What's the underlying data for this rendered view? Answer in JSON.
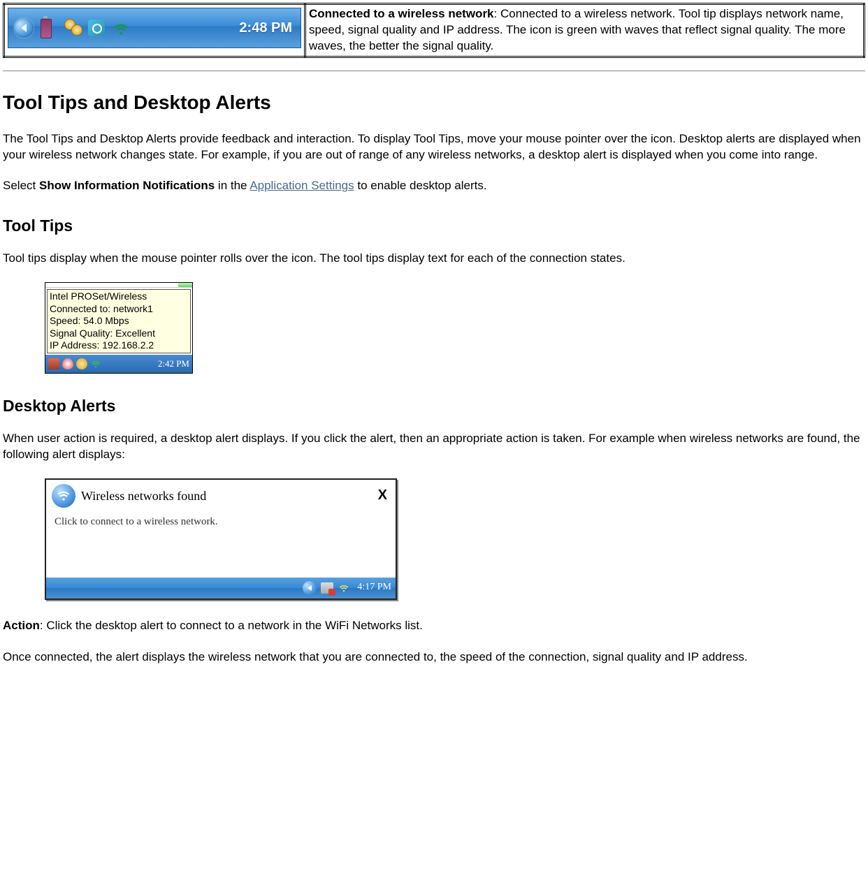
{
  "iconTable": {
    "taskbar": {
      "time": "2:48 PM"
    },
    "description": {
      "title": "Connected to a wireless network",
      "body": ": Connected to a wireless network. Tool tip displays network name, speed, signal quality and IP address. The icon is green with waves that reflect signal quality. The more waves, the better the signal quality."
    }
  },
  "h2": "Tool Tips and Desktop Alerts",
  "intro": "The Tool Tips and Desktop Alerts provide feedback and interaction. To display Tool Tips, move your mouse pointer over the icon. Desktop alerts are displayed when your wireless network changes state. For example, if you are out of range of any wireless networks, a desktop alert is displayed when you come into range.",
  "enable": {
    "pre": "Select ",
    "bold": "Show Information Notifications",
    "mid": " in the ",
    "link": "Application Settings",
    "post": " to enable desktop alerts."
  },
  "tooltips": {
    "heading": "Tool Tips",
    "para": "Tool tips display when the mouse pointer rolls over the icon. The tool tips display text for each of the connection states.",
    "figure": {
      "line1": "Intel PROSet/Wireless",
      "line2": "Connected to: network1",
      "line3": "Speed: 54.0 Mbps",
      "line4": "Signal Quality: Excellent",
      "line5": "IP Address: 192.168.2.2",
      "time": "2:42 PM"
    }
  },
  "alerts": {
    "heading": "Desktop Alerts",
    "para": "When user action is required, a desktop alert displays. If you click the alert, then an appropriate action is taken. For example when wireless networks are found, the following alert displays:",
    "figure": {
      "title": "Wireless networks found",
      "body": "Click to connect to a wireless network.",
      "close": "X",
      "time": "4:17 PM"
    },
    "action": {
      "label": "Action",
      "text": ": Click the desktop alert to connect to a network in the WiFi Networks list."
    },
    "final": "Once connected, the alert displays the wireless network that you are connected to, the speed of the connection, signal quality and IP address."
  }
}
